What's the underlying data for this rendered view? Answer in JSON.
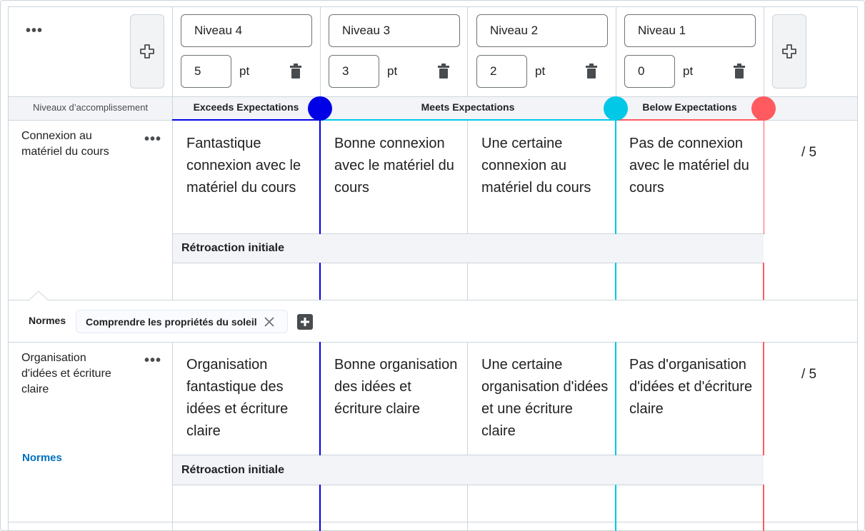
{
  "header": {
    "more_label": "•••",
    "levels": [
      {
        "name": "Niveau 4",
        "points": "5",
        "pt_label": "pt"
      },
      {
        "name": "Niveau 3",
        "points": "3",
        "pt_label": "pt"
      },
      {
        "name": "Niveau 2",
        "points": "2",
        "pt_label": "pt"
      },
      {
        "name": "Niveau 1",
        "points": "0",
        "pt_label": "pt"
      }
    ]
  },
  "achievement": {
    "label": "Niveaux d’accomplissement",
    "bands": [
      {
        "label": "Exceeds Expectations",
        "color": "#0000e6"
      },
      {
        "label": "Meets Expectations",
        "color": "#00c8e6"
      },
      {
        "label": "Below Expectations",
        "color": "#ff5a5f"
      }
    ]
  },
  "criteria": [
    {
      "name": "Connexion au matériel du cours",
      "more_label": "•••",
      "cells": [
        "Fantastique connexion avec le matériel du cours",
        "Bonne connexion avec le matériel du cours",
        "Une certaine connexion au matériel du cours",
        "Pas de connexion avec le matériel du cours"
      ],
      "score": "/ 5",
      "feedback_label": "Rétroaction initiale"
    },
    {
      "name": "Organisation d'idées et écriture claire",
      "more_label": "•••",
      "link": "Normes",
      "cells": [
        "Organisation fantastique des idées et écriture claire",
        "Bonne organisation des idées et écriture claire",
        "Une certaine organisation d'idées et une écriture claire",
        "Pas d'organisation d'idées et d'écriture claire"
      ],
      "score": "/ 5",
      "feedback_label": "Rétroaction initiale"
    }
  ],
  "standards": {
    "label": "Normes",
    "chip": "Comprendre les propriétés du soleil"
  },
  "colors": {
    "exceeds": "#0000e6",
    "meets": "#00c8e6",
    "below": "#ff5a5f",
    "link": "#006fbf"
  }
}
